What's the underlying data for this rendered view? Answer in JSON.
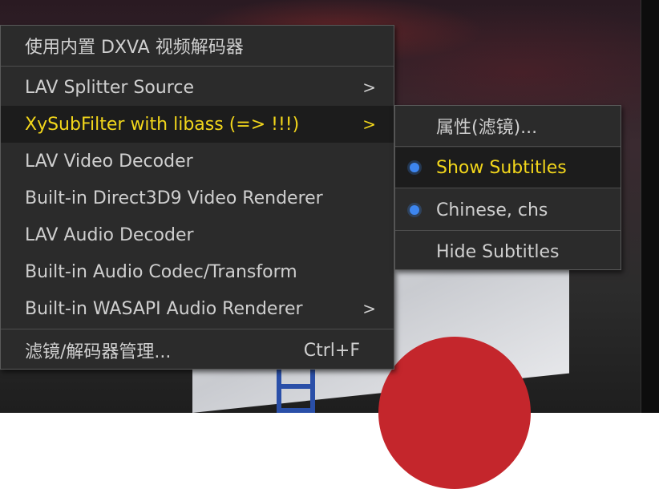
{
  "main_menu": {
    "items": [
      {
        "label": "使用内置 DXVA 视频解码器"
      },
      {
        "label": "LAV Splitter Source",
        "arrow": ">"
      },
      {
        "label": "XySubFilter with libass (=> !!!)",
        "arrow": ">",
        "highlighted": true
      },
      {
        "label": "LAV Video Decoder"
      },
      {
        "label": "Built-in Direct3D9 Video Renderer"
      },
      {
        "label": "LAV Audio Decoder"
      },
      {
        "label": "Built-in Audio Codec/Transform"
      },
      {
        "label": "Built-in WASAPI Audio Renderer",
        "arrow": ">"
      },
      {
        "label": "滤镜/解码器管理...",
        "shortcut": "Ctrl+F"
      }
    ]
  },
  "sub_menu": {
    "items": [
      {
        "label": "属性(滤镜)..."
      },
      {
        "label": "Show Subtitles",
        "checked": true,
        "highlighted": true
      },
      {
        "label": "Chinese, chs",
        "checked": true
      },
      {
        "label": "Hide Subtitles"
      }
    ]
  },
  "colors": {
    "menu_bg": "#2b2b2b",
    "highlight_bg": "#1c1c1c",
    "highlight_text": "#f2d61b",
    "text": "#cfcfcf",
    "radio": "#3d86f0"
  }
}
